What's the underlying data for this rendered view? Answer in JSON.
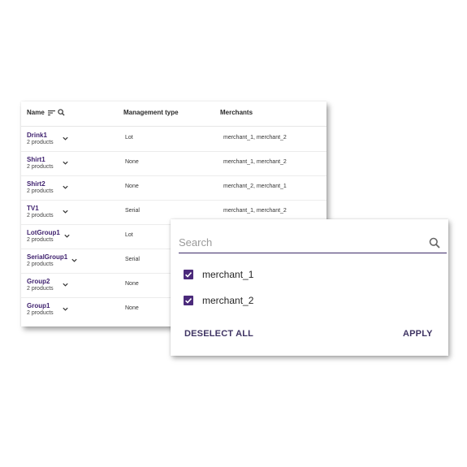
{
  "table": {
    "headers": {
      "name": "Name",
      "management_type": "Management type",
      "merchants": "Merchants"
    },
    "rows": [
      {
        "name": "Drink1",
        "count": "2 products",
        "management": "Lot",
        "merchants": "merchant_1, merchant_2"
      },
      {
        "name": "Shirt1",
        "count": "2 products",
        "management": "None",
        "merchants": "merchant_1, merchant_2"
      },
      {
        "name": "Shirt2",
        "count": "2 products",
        "management": "None",
        "merchants": "merchant_2, merchant_1"
      },
      {
        "name": "TV1",
        "count": "2 products",
        "management": "Serial",
        "merchants": "merchant_1, merchant_2"
      },
      {
        "name": "LotGroup1",
        "count": "2 products",
        "management": "Lot",
        "merchants": ""
      },
      {
        "name": "SerialGroup1",
        "count": "2 products",
        "management": "Serial",
        "merchants": ""
      },
      {
        "name": "Group2",
        "count": "2 products",
        "management": "None",
        "merchants": ""
      },
      {
        "name": "Group1",
        "count": "2 products",
        "management": "None",
        "merchants": ""
      }
    ]
  },
  "filter": {
    "search_placeholder": "Search",
    "options": [
      {
        "label": "merchant_1",
        "checked": true
      },
      {
        "label": "merchant_2",
        "checked": true
      }
    ],
    "deselect_label": "DESELECT ALL",
    "apply_label": "APPLY"
  },
  "colors": {
    "accent": "#4b2a7b",
    "name_text": "#3d1f6d",
    "button_text": "#3f3463"
  }
}
